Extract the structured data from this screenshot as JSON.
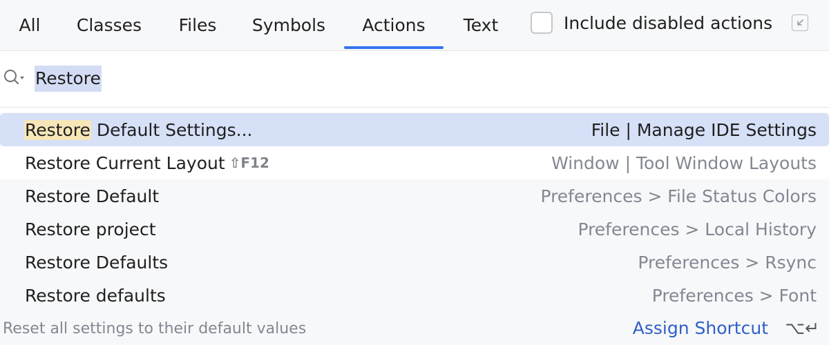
{
  "tabs": [
    {
      "label": "All",
      "active": false
    },
    {
      "label": "Classes",
      "active": false
    },
    {
      "label": "Files",
      "active": false
    },
    {
      "label": "Symbols",
      "active": false
    },
    {
      "label": "Actions",
      "active": true
    },
    {
      "label": "Text",
      "active": false
    }
  ],
  "include_disabled": {
    "label": "Include disabled actions",
    "checked": false
  },
  "search": {
    "query": "Restore"
  },
  "results": [
    {
      "match": "Restore",
      "name": " Default Settings...",
      "shortcut": "",
      "location": "File | Manage IDE Settings"
    },
    {
      "match": "",
      "name": "Restore Current Layout",
      "shortcut": "⇧F12",
      "location": "Window | Tool Window Layouts"
    },
    {
      "match": "",
      "name": "Restore Default",
      "shortcut": "",
      "location": "Preferences > File Status Colors"
    },
    {
      "match": "",
      "name": "Restore project",
      "shortcut": "",
      "location": "Preferences > Local History"
    },
    {
      "match": "",
      "name": "Restore Defaults",
      "shortcut": "",
      "location": "Preferences > Rsync"
    },
    {
      "match": "",
      "name": "Restore defaults",
      "shortcut": "",
      "location": "Preferences > Font"
    }
  ],
  "footer": {
    "hint": "Reset all settings to their default values",
    "assign_label": "Assign Shortcut",
    "assign_keys": "⌥↵"
  },
  "colors": {
    "accent": "#3574f0",
    "selected_row": "#d6e0f7",
    "match_highlight": "#f6e6b8"
  }
}
